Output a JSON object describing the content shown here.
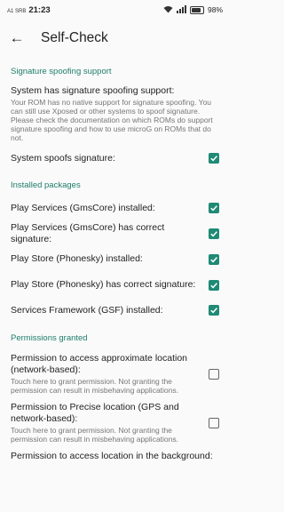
{
  "status": {
    "carrier": "A1 SRB",
    "time": "21:23",
    "battery": "98%"
  },
  "appbar": {
    "title": "Self-Check"
  },
  "sections": {
    "spoof": {
      "header": "Signature spoofing support",
      "item1_title": "System has signature spoofing support:",
      "item1_summary": "Your ROM has no native support for signature spoofing. You can still use Xposed or other systems to spoof signature. Please check the documentation on which ROMs do support signature spoofing and how to use microG on ROMs that do not.",
      "item2_title": "System spoofs signature:"
    },
    "installed": {
      "header": "Installed packages",
      "items": [
        "Play Services (GmsCore) installed:",
        "Play Services (GmsCore) has correct signature:",
        "Play Store (Phonesky) installed:",
        "Play Store (Phonesky) has correct signature:",
        "Services Framework (GSF) installed:"
      ]
    },
    "perms": {
      "header": "Permissions granted",
      "item1_title": "Permission to access approximate location (network-based):",
      "item1_summary": "Touch here to grant permission. Not granting the permission can result in misbehaving applications.",
      "item2_title": "Permission to Precise location (GPS and network-based):",
      "item2_summary": "Touch here to grant permission. Not granting the permission can result in misbehaving applications.",
      "item3_title": "Permission to access location in the background:"
    }
  },
  "colors": {
    "accent": "#1f8a75",
    "section": "#1e7d6a"
  },
  "icons": {
    "back": "arrow-back-icon",
    "check": "check-icon",
    "wifi": "wifi-icon",
    "signal": "signal-icon",
    "battery": "battery-icon"
  }
}
